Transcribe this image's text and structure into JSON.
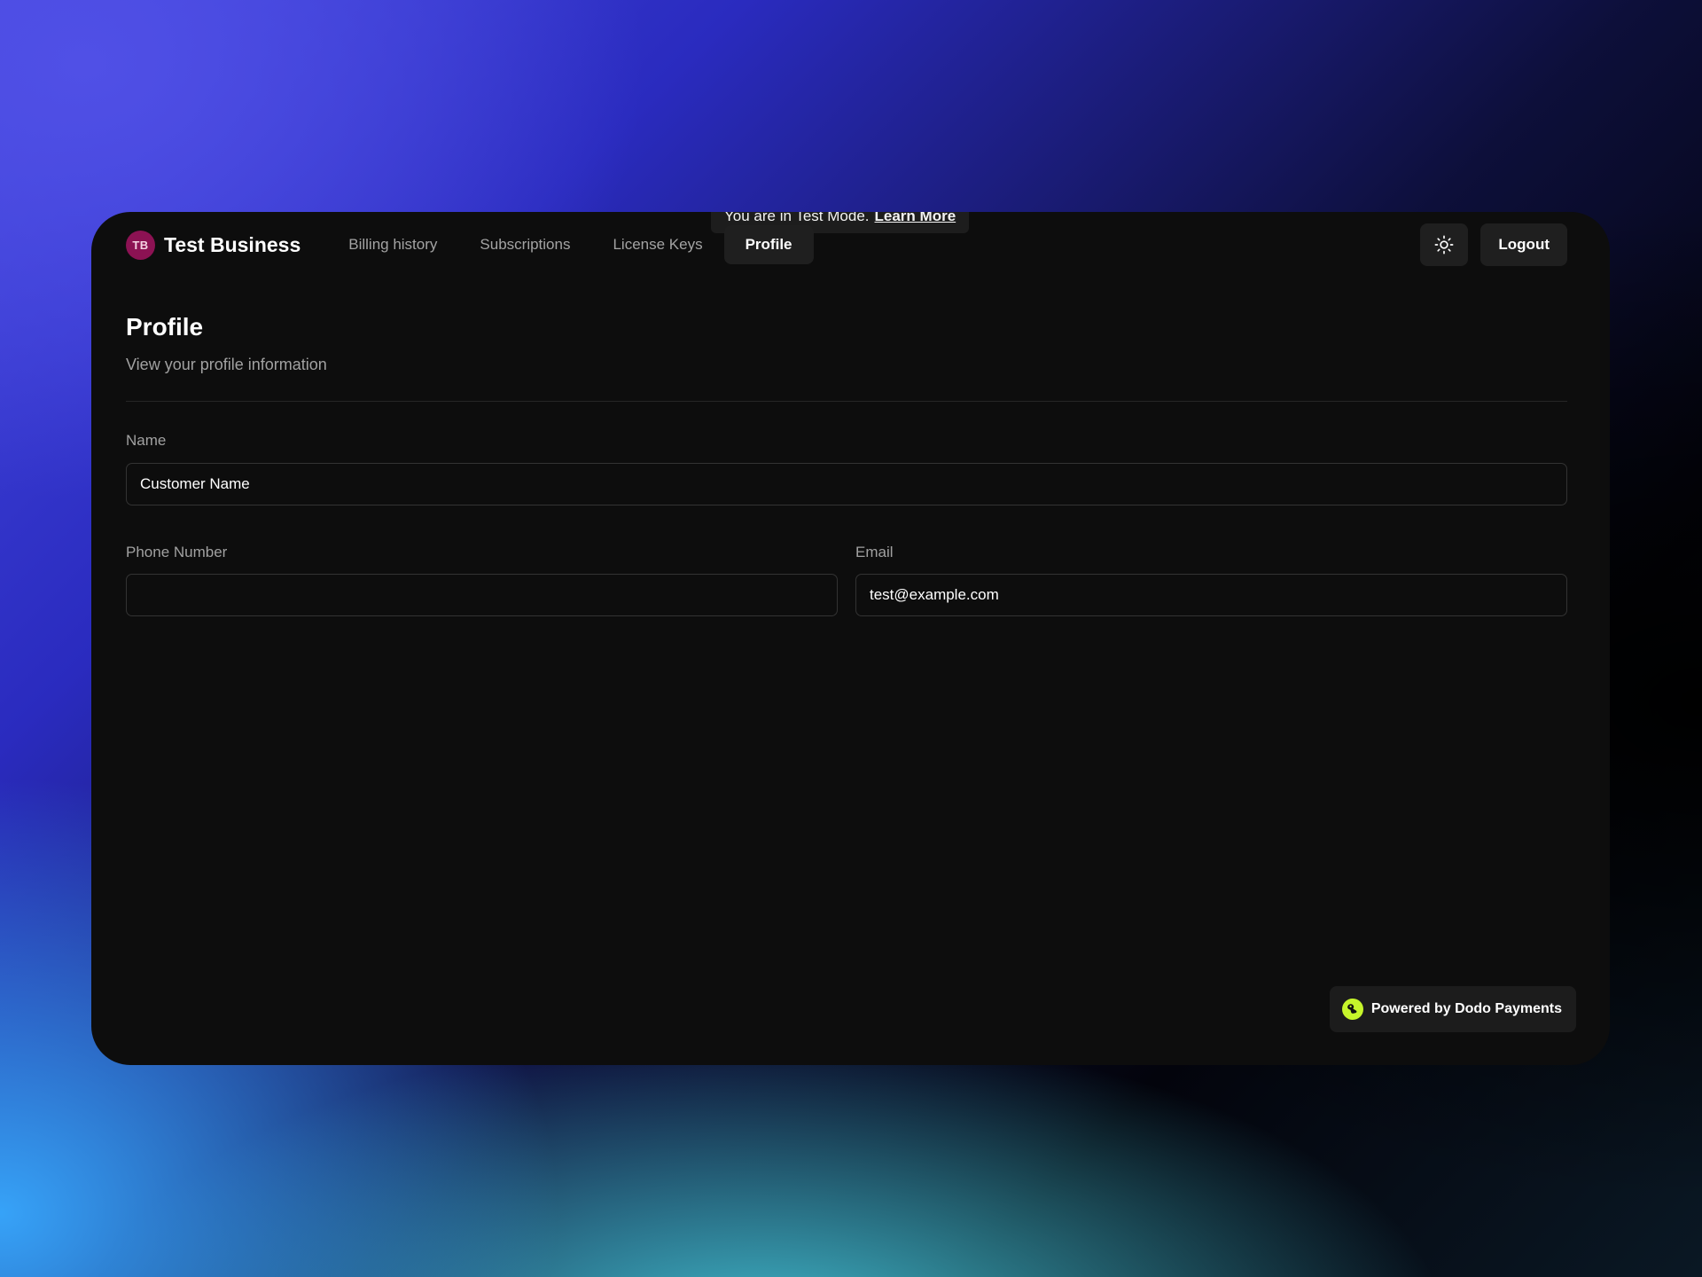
{
  "banner": {
    "text": "You are in Test Mode.",
    "link_label": "Learn More"
  },
  "brand": {
    "initials": "TB",
    "name": "Test Business",
    "avatar_color": "#8c1253"
  },
  "nav": {
    "items": [
      {
        "label": "Billing history",
        "active": false
      },
      {
        "label": "Subscriptions",
        "active": false
      },
      {
        "label": "License Keys",
        "active": false
      },
      {
        "label": "Profile",
        "active": true
      }
    ]
  },
  "actions": {
    "theme_icon": "sun-icon",
    "logout_label": "Logout"
  },
  "page": {
    "title": "Profile",
    "subtitle": "View your profile information"
  },
  "form": {
    "name": {
      "label": "Name",
      "value": "Customer Name",
      "placeholder": ""
    },
    "phone": {
      "label": "Phone Number",
      "value": "",
      "placeholder": ""
    },
    "email": {
      "label": "Email",
      "value": "test@example.com",
      "placeholder": ""
    }
  },
  "footer": {
    "powered_label": "Powered by Dodo Payments",
    "logo_icon": "dodo-payments-logo-icon",
    "logo_color": "#c6f52b"
  },
  "colors": {
    "card_background": "#0d0d0d",
    "active_tab": "#1f1f1f",
    "muted_text": "#a1a1a1"
  }
}
